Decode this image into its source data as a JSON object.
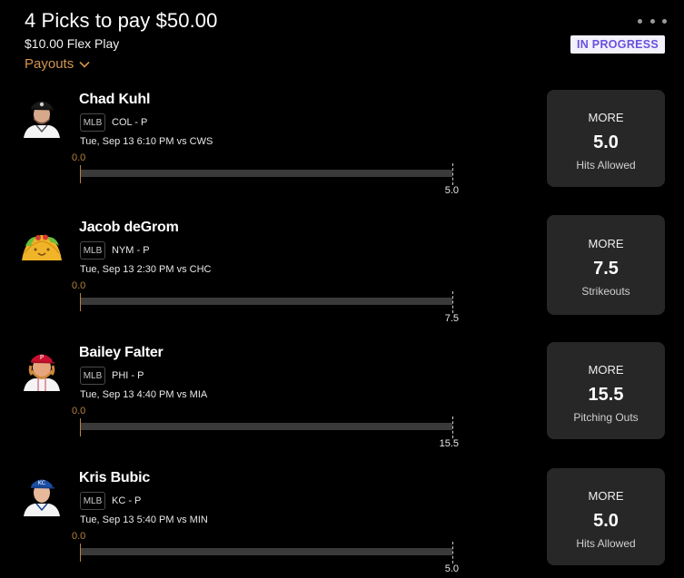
{
  "header": {
    "title": "4 Picks to pay $50.00",
    "subtitle": "$10.00 Flex Play",
    "payouts_label": "Payouts",
    "status": "IN PROGRESS"
  },
  "colors": {
    "background": "#000000",
    "card": "#272727",
    "accent_gold": "#d3954d",
    "status_purple": "#6a51e0",
    "track": "#3a3a3a"
  },
  "picks": [
    {
      "player": "Chad Kuhl",
      "league": "MLB",
      "team_pos": "COL - P",
      "game": "Tue, Sep 13 6:10 PM  vs CWS",
      "current": "0.0",
      "target": "5.0",
      "direction": "MORE",
      "line": "5.0",
      "stat": "Hits Allowed",
      "avatar": "player-headshot-rockies"
    },
    {
      "player": "Jacob deGrom",
      "league": "MLB",
      "team_pos": "NYM - P",
      "game": "Tue, Sep 13 2:30 PM  vs CHC",
      "current": "0.0",
      "target": "7.5",
      "direction": "MORE",
      "line": "7.5",
      "stat": "Strikeouts",
      "avatar": "taco-icon"
    },
    {
      "player": "Bailey Falter",
      "league": "MLB",
      "team_pos": "PHI - P",
      "game": "Tue, Sep 13 4:40 PM  vs MIA",
      "current": "0.0",
      "target": "15.5",
      "direction": "MORE",
      "line": "15.5",
      "stat": "Pitching Outs",
      "avatar": "player-headshot-phillies"
    },
    {
      "player": "Kris Bubic",
      "league": "MLB",
      "team_pos": "KC - P",
      "game": "Tue, Sep 13 5:40 PM  vs MIN",
      "current": "0.0",
      "target": "5.0",
      "direction": "MORE",
      "line": "5.0",
      "stat": "Hits Allowed",
      "avatar": "player-headshot-royals"
    }
  ]
}
